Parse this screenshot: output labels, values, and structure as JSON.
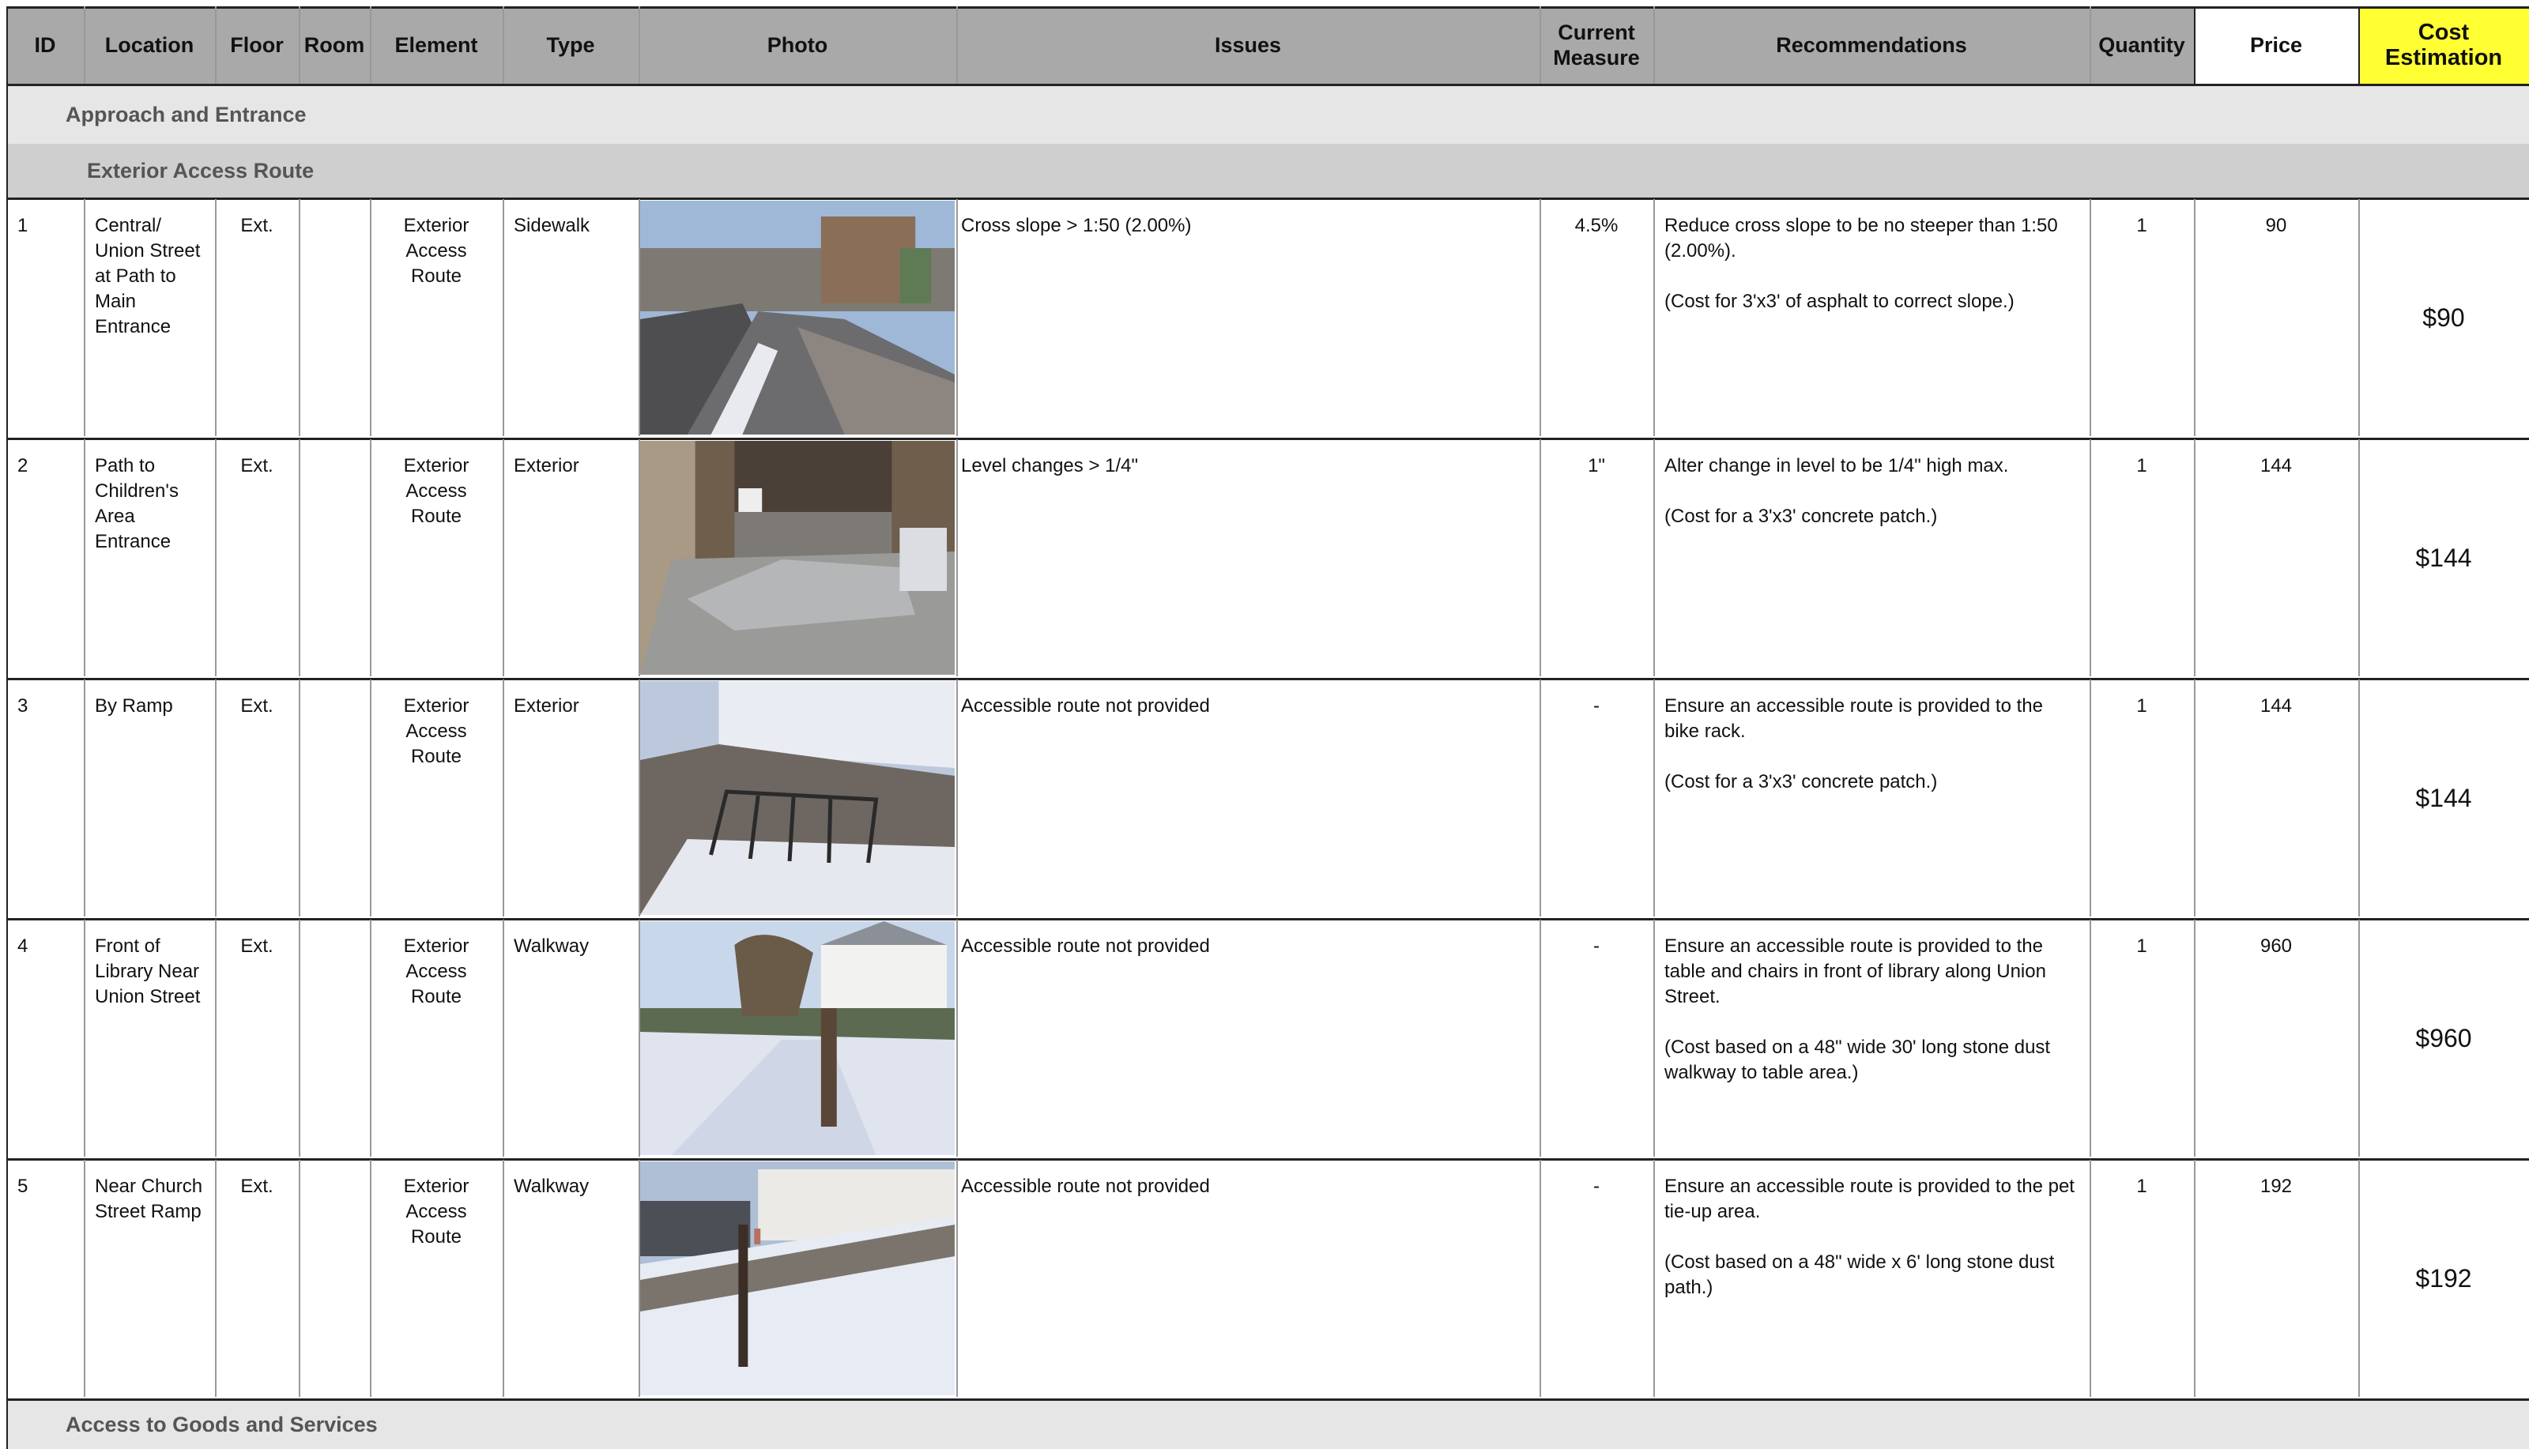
{
  "columns": [
    {
      "key": "id",
      "label": "ID"
    },
    {
      "key": "location",
      "label": "Location"
    },
    {
      "key": "floor",
      "label": "Floor"
    },
    {
      "key": "room",
      "label": "Room"
    },
    {
      "key": "element",
      "label": "Element"
    },
    {
      "key": "type",
      "label": "Type"
    },
    {
      "key": "photo",
      "label": "Photo"
    },
    {
      "key": "issues",
      "label": "Issues"
    },
    {
      "key": "current_measure",
      "label": "Current\nMeasure"
    },
    {
      "key": "recommendations",
      "label": "Recommendations"
    },
    {
      "key": "quantity",
      "label": "Quantity"
    },
    {
      "key": "price",
      "label": "Price"
    },
    {
      "key": "cost",
      "label": "Cost\nEstimation"
    }
  ],
  "colors": {
    "header_bg": "#a9a9a9",
    "price_header_bg": "#ffffff",
    "cost_bg": "#ffff33",
    "section_bg": "#e6e6e6",
    "subsection_bg": "#cfcfcf",
    "section_text": "#555555"
  },
  "sections": {
    "approach": "Approach and Entrance",
    "exterior_route": "Exterior Access Route",
    "goods": "Access to Goods and Services"
  },
  "rows": [
    {
      "id": "1",
      "location": "Central/\nUnion Street\nat Path to\nMain\nEntrance",
      "floor": "Ext.",
      "room": "",
      "element": "Exterior\nAccess\nRoute",
      "type": "Sidewalk",
      "photo_icon": "sidewalk-photo",
      "issues": "Cross slope > 1:50 (2.00%)",
      "current_measure": "4.5%",
      "recommendations": "Reduce cross slope to be no steeper than 1:50\n(2.00%).\n\n(Cost for 3'x3' of asphalt to correct slope.)",
      "quantity": "1",
      "price": "90",
      "cost": "$90"
    },
    {
      "id": "2",
      "location": "Path to\nChildren's\nArea\nEntrance",
      "floor": "Ext.",
      "room": "",
      "element": "Exterior\nAccess\nRoute",
      "type": "Exterior",
      "photo_icon": "entrance-steps-photo",
      "issues": "Level changes > 1/4\"",
      "current_measure": "1\"",
      "recommendations": "Alter change in level to be 1/4\" high max.\n\n(Cost for a 3'x3' concrete patch.)",
      "quantity": "1",
      "price": "144",
      "cost": "$144"
    },
    {
      "id": "3",
      "location": "By Ramp",
      "floor": "Ext.",
      "room": "",
      "element": "Exterior\nAccess\nRoute",
      "type": "Exterior",
      "photo_icon": "bike-rack-photo",
      "issues": "Accessible route not provided",
      "current_measure": "-",
      "recommendations": "Ensure an accessible route is provided to the\nbike rack.\n\n(Cost for a 3'x3' concrete patch.)",
      "quantity": "1",
      "price": "144",
      "cost": "$144"
    },
    {
      "id": "4",
      "location": "Front of\nLibrary Near\nUnion Street",
      "floor": "Ext.",
      "room": "",
      "element": "Exterior\nAccess\nRoute",
      "type": "Walkway",
      "photo_icon": "snowy-lawn-photo",
      "issues": "Accessible route not provided",
      "current_measure": "-",
      "recommendations": "Ensure an accessible route is provided to the\ntable and chairs in front of library along Union\nStreet.\n\n(Cost based on a 48\" wide 30' long stone dust\nwalkway to table area.)",
      "quantity": "1",
      "price": "960",
      "cost": "$960"
    },
    {
      "id": "5",
      "location": "Near Church\nStreet Ramp",
      "floor": "Ext.",
      "room": "",
      "element": "Exterior\nAccess\nRoute",
      "type": "Walkway",
      "photo_icon": "pet-tie-up-photo",
      "issues": "Accessible route not provided",
      "current_measure": "-",
      "recommendations": "Ensure an accessible route is provided to the pet\ntie-up area.\n\n(Cost based on a 48\" wide x 6' long stone dust\npath.)",
      "quantity": "1",
      "price": "192",
      "cost": "$192"
    }
  ]
}
